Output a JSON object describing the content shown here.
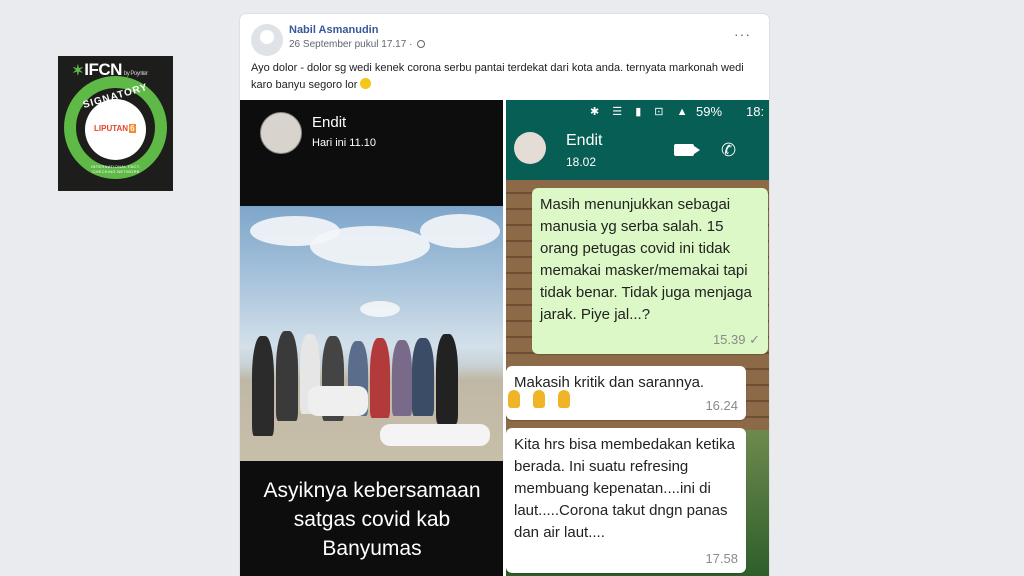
{
  "badge": {
    "brand": "IFCN",
    "brand_sub": "by Poynter",
    "signatory": "SIGNATORY",
    "member": "LIPUTAN",
    "member_num": "6",
    "ring_text": "INTERNATIONAL FACT-CHECKING NETWORK"
  },
  "post": {
    "author": "Nabil Asmanudin",
    "timestamp": "26 September pukul 17.17 ·",
    "more_label": "···",
    "caption": "Ayo dolor - dolor sg wedi kenek corona serbu pantai terdekat dari kota anda. ternyata markonah wedi karo banyu segoro lor"
  },
  "story": {
    "name": "Endit",
    "time": "Hari ini 11.10",
    "caption_line1": "Asyiknya kebersamaan",
    "caption_line2": "satgas covid kab",
    "caption_line3": "Banyumas"
  },
  "whatsapp": {
    "status_icons": "✱ ☰ ▮ ⊡ ▲",
    "battery": "59%",
    "clock": "18:",
    "contact_name": "Endit",
    "contact_time": "18.02",
    "messages": [
      {
        "text": "Masih menunjukkan sebagai manusia yg serba salah. 15 orang petugas covid ini tidak memakai masker/memakai tapi tidak benar. Tidak juga menjaga jarak. Piye jal...?",
        "time": "15.39 ✓"
      },
      {
        "text": "Makasih kritik dan sarannya.",
        "time": "16.24"
      },
      {
        "text": "Kita hrs bisa membedakan ketika berada. Ini suatu refresing membuang kepenatan....ini di laut.....Corona takut dngn panas dan air laut....",
        "time": "17.58"
      }
    ]
  },
  "colors": {
    "page_bg": "#e9ebee",
    "fb_link": "#385898",
    "wa_header": "#075e54",
    "wa_outgoing": "#dcf8c6",
    "ifcn_green": "#5fb946"
  }
}
